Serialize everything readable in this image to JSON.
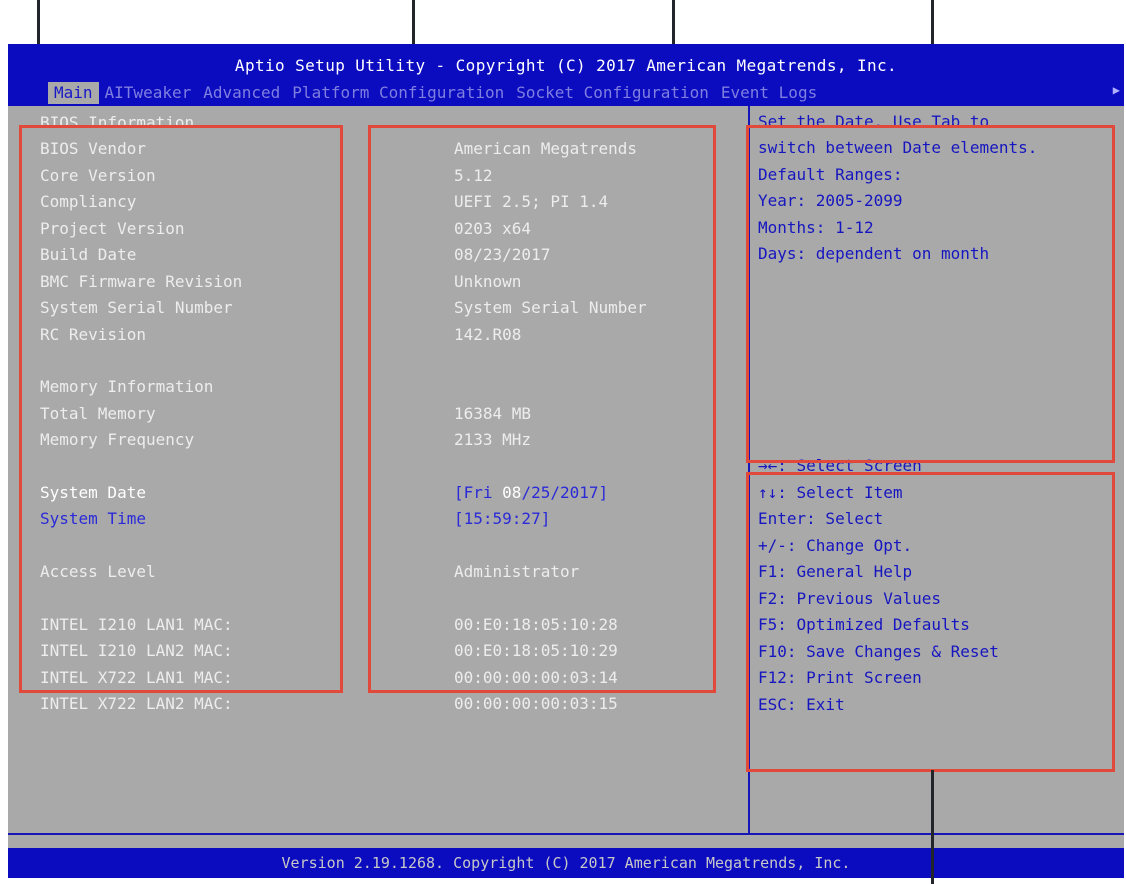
{
  "header": {
    "title": "Aptio Setup Utility - Copyright (C) 2017 American Megatrends, Inc.",
    "tabs": [
      {
        "label": "Main",
        "active": true
      },
      {
        "label": "AITweaker",
        "active": false
      },
      {
        "label": "Advanced",
        "active": false
      },
      {
        "label": "Platform Configuration",
        "active": false
      },
      {
        "label": "Socket Configuration",
        "active": false
      },
      {
        "label": "Event Logs",
        "active": false
      }
    ],
    "more_icon": "triangle-right-icon"
  },
  "main": {
    "rows": [
      {
        "label": "BIOS Information",
        "value": ""
      },
      {
        "label": "BIOS Vendor",
        "value": "American Megatrends"
      },
      {
        "label": "Core Version",
        "value": "5.12"
      },
      {
        "label": "Compliancy",
        "value": "UEFI 2.5; PI 1.4"
      },
      {
        "label": "Project Version",
        "value": "0203 x64"
      },
      {
        "label": "Build Date",
        "value": "08/23/2017"
      },
      {
        "label": "BMC Firmware Revision",
        "value": "Unknown"
      },
      {
        "label": "System Serial Number",
        "value": "System Serial Number"
      },
      {
        "label": "RC Revision",
        "value": "142.R08"
      },
      {
        "label": "Memory Information",
        "value": ""
      },
      {
        "label": "Total Memory",
        "value": "16384 MB"
      },
      {
        "label": "Memory Frequency",
        "value": "2133 MHz"
      },
      {
        "label": "System Date",
        "value_prefix": "[Fri ",
        "value_highlight": "08",
        "value_suffix": "/25/2017]"
      },
      {
        "label": "System Time",
        "value": "[15:59:27]"
      },
      {
        "label": "Access Level",
        "value": "Administrator"
      },
      {
        "label": "INTEL I210 LAN1 MAC:",
        "value": "00:E0:18:05:10:28"
      },
      {
        "label": "INTEL I210 LAN2 MAC:",
        "value": "00:E0:18:05:10:29"
      },
      {
        "label": "INTEL X722 LAN1 MAC:",
        "value": "00:00:00:00:03:14"
      },
      {
        "label": "INTEL X722 LAN2 MAC:",
        "value": "00:00:00:00:03:15"
      }
    ]
  },
  "help": {
    "lines": [
      "Set the Date. Use Tab to",
      "switch between Date elements.",
      "Default Ranges:",
      "Year: 2005-2099",
      "Months: 1-12",
      "Days: dependent on month"
    ]
  },
  "keys": {
    "lines": [
      "→←: Select Screen",
      "↑↓: Select Item",
      "Enter: Select",
      "+/-: Change Opt.",
      "F1: General Help",
      "F2: Previous Values",
      "F5: Optimized Defaults",
      "F10: Save Changes & Reset",
      "F12: Print Screen",
      "ESC: Exit"
    ]
  },
  "footer": {
    "text": "Version 2.19.1268. Copyright (C) 2017 American Megatrends, Inc."
  },
  "colors": {
    "header_bg": "#0b0bc0",
    "body_bg": "#a9a9a9",
    "highlight": "#2a2ad8",
    "annotation": "#e14a3a"
  }
}
